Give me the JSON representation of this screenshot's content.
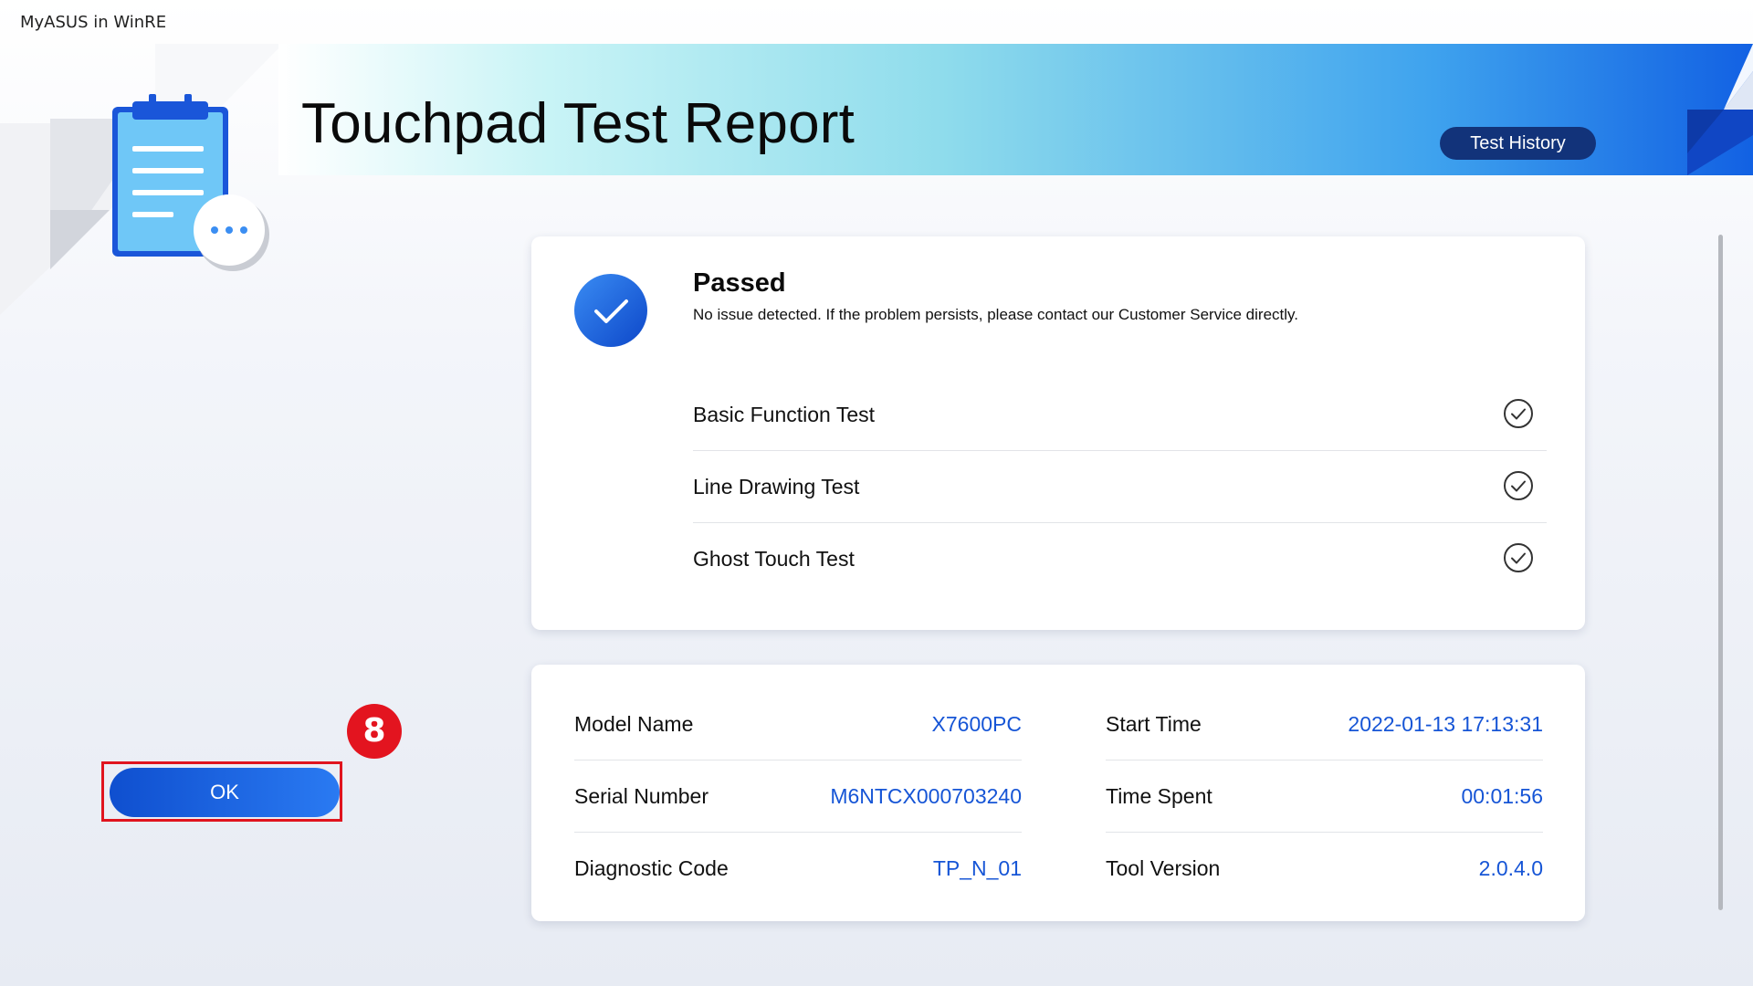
{
  "window": {
    "app_title": "MyASUS in WinRE"
  },
  "header": {
    "title": "Touchpad Test Report",
    "history_button_label": "Test History"
  },
  "result": {
    "status_title": "Passed",
    "status_description": "No issue detected. If the problem persists, please contact our Customer Service directly.",
    "tests": [
      {
        "name": "Basic Function Test",
        "result_icon": "check-circle-icon"
      },
      {
        "name": "Line Drawing Test",
        "result_icon": "check-circle-icon"
      },
      {
        "name": "Ghost Touch Test",
        "result_icon": "check-circle-icon"
      }
    ]
  },
  "info": {
    "left": [
      {
        "label": "Model Name",
        "value": "X7600PC"
      },
      {
        "label": "Serial Number",
        "value": "M6NTCX000703240"
      },
      {
        "label": "Diagnostic Code",
        "value": "TP_N_01"
      }
    ],
    "right": [
      {
        "label": "Start Time",
        "value": "2022-01-13 17:13:31"
      },
      {
        "label": "Time Spent",
        "value": "00:01:56"
      },
      {
        "label": "Tool Version",
        "value": "2.0.4.0"
      }
    ]
  },
  "actions": {
    "ok_label": "OK",
    "step_badge": "8"
  },
  "colors": {
    "accent": "#1655d6",
    "history_button": "#12337a",
    "highlight": "#e0141e"
  }
}
